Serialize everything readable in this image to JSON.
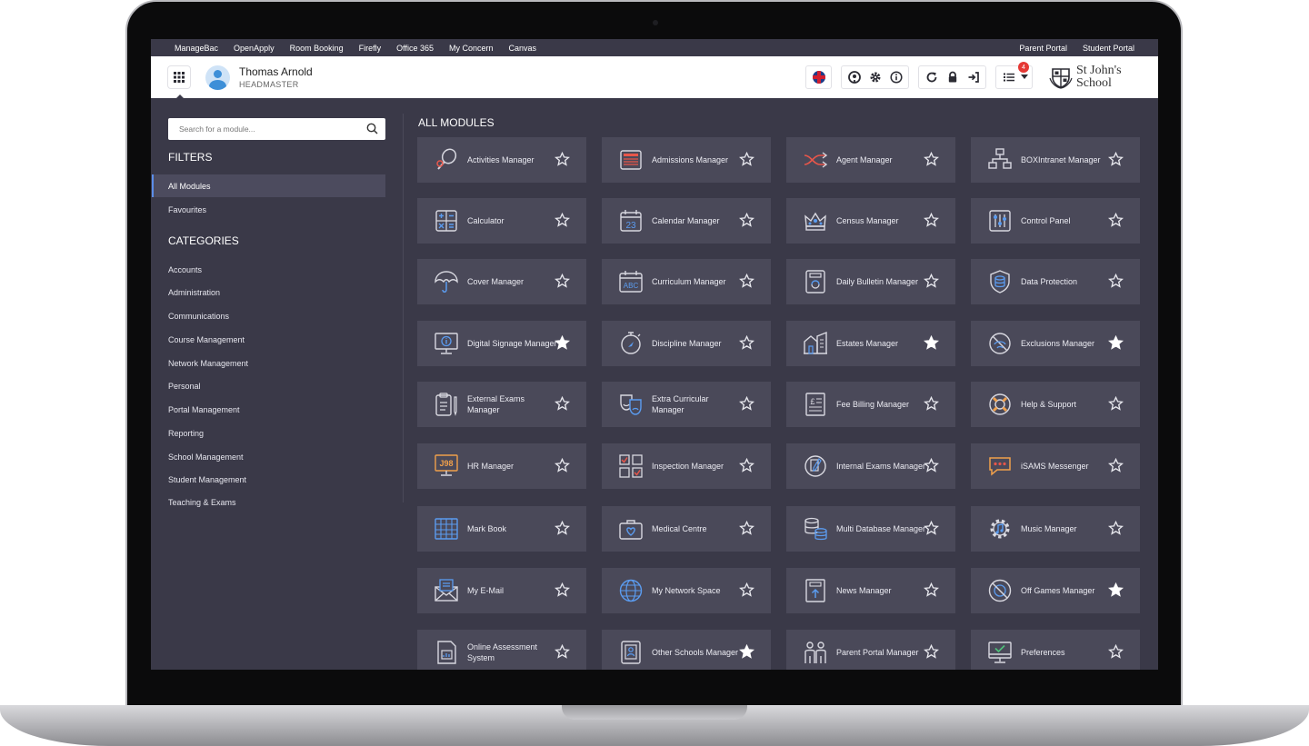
{
  "topnav": {
    "links": [
      "ManageBac",
      "OpenApply",
      "Room Booking",
      "Firefly",
      "Office 365",
      "My Concern",
      "Canvas"
    ],
    "right_links": [
      "Parent Portal",
      "Student Portal"
    ]
  },
  "header": {
    "user_name": "Thomas Arnold",
    "user_role": "HEADMASTER",
    "notification_count": "4",
    "school_name": "St John's School"
  },
  "sidebar": {
    "search_placeholder": "Search for a module...",
    "filters_title": "FILTERS",
    "filters": [
      "All Modules",
      "Favourites"
    ],
    "active_filter": "All Modules",
    "categories_title": "CATEGORIES",
    "categories": [
      "Accounts",
      "Administration",
      "Communications",
      "Course Management",
      "Network Management",
      "Personal",
      "Portal Management",
      "Reporting",
      "School Management",
      "Student Management",
      "Teaching & Exams"
    ]
  },
  "modules": {
    "title": "ALL MODULES",
    "items": [
      {
        "label": "Activities Manager",
        "icon": "racket-icon",
        "favourite": false
      },
      {
        "label": "Admissions Manager",
        "icon": "document-list-icon",
        "favourite": false
      },
      {
        "label": "Agent Manager",
        "icon": "shuffle-icon",
        "favourite": false
      },
      {
        "label": "BOXIntranet Manager",
        "icon": "network-icon",
        "favourite": false
      },
      {
        "label": "Calculator",
        "icon": "calculator-icon",
        "favourite": false
      },
      {
        "label": "Calendar Manager",
        "icon": "calendar-icon",
        "favourite": false
      },
      {
        "label": "Census Manager",
        "icon": "crown-icon",
        "favourite": false
      },
      {
        "label": "Control Panel",
        "icon": "sliders-icon",
        "favourite": false
      },
      {
        "label": "Cover Manager",
        "icon": "umbrella-icon",
        "favourite": false
      },
      {
        "label": "Curriculum Manager",
        "icon": "abc-calendar-icon",
        "favourite": false
      },
      {
        "label": "Daily Bulletin Manager",
        "icon": "bulletin-icon",
        "favourite": false
      },
      {
        "label": "Data Protection",
        "icon": "shield-database-icon",
        "favourite": false
      },
      {
        "label": "Digital Signage Manager",
        "icon": "monitor-info-icon",
        "favourite": true
      },
      {
        "label": "Discipline Manager",
        "icon": "stopwatch-icon",
        "favourite": false
      },
      {
        "label": "Estates Manager",
        "icon": "buildings-icon",
        "favourite": true
      },
      {
        "label": "Exclusions Manager",
        "icon": "exclusion-icon",
        "favourite": true
      },
      {
        "label": "External Exams Manager",
        "icon": "clipboard-pen-icon",
        "favourite": false
      },
      {
        "label": "Extra Curricular Manager",
        "icon": "theatre-masks-icon",
        "favourite": false
      },
      {
        "label": "Fee Billing Manager",
        "icon": "invoice-icon",
        "favourite": false
      },
      {
        "label": "Help & Support",
        "icon": "lifebuoy-icon",
        "favourite": false
      },
      {
        "label": "HR Manager",
        "icon": "hr-screen-icon",
        "favourite": false
      },
      {
        "label": "Inspection Manager",
        "icon": "checklist-grid-icon",
        "favourite": false
      },
      {
        "label": "Internal Exams Manager",
        "icon": "exam-pen-icon",
        "favourite": false
      },
      {
        "label": "iSAMS Messenger",
        "icon": "chat-bubble-icon",
        "favourite": false
      },
      {
        "label": "Mark Book",
        "icon": "gradebook-icon",
        "favourite": false
      },
      {
        "label": "Medical Centre",
        "icon": "medical-bag-icon",
        "favourite": false
      },
      {
        "label": "Multi Database Manager",
        "icon": "multi-database-icon",
        "favourite": false
      },
      {
        "label": "Music Manager",
        "icon": "music-gear-icon",
        "favourite": false
      },
      {
        "label": "My E-Mail",
        "icon": "envelope-icon",
        "favourite": false
      },
      {
        "label": "My Network Space",
        "icon": "globe-icon",
        "favourite": false
      },
      {
        "label": "News Manager",
        "icon": "news-upload-icon",
        "favourite": false
      },
      {
        "label": "Off Games Manager",
        "icon": "no-ball-icon",
        "favourite": true
      },
      {
        "label": "Online Assessment System",
        "icon": "online-assessment-icon",
        "favourite": false
      },
      {
        "label": "Other Schools Manager",
        "icon": "school-id-icon",
        "favourite": true
      },
      {
        "label": "Parent Portal Manager",
        "icon": "parents-icon",
        "favourite": false
      },
      {
        "label": "Preferences",
        "icon": "monitor-check-icon",
        "favourite": false
      }
    ]
  },
  "colors": {
    "background": "#3a3948",
    "tile": "#4a4959",
    "icon_blue": "#5b9cf0",
    "icon_red": "#e8564a",
    "icon_orange": "#f0a04b",
    "icon_grey": "#d8d8e0"
  }
}
